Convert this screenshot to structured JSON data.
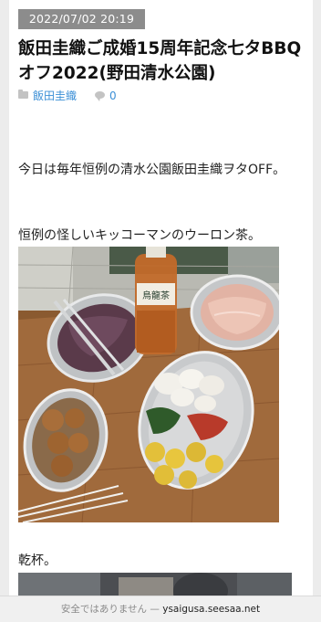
{
  "post": {
    "date": "2022/07/02 20:19",
    "title": "飯田圭織ご成婚15周年記念七タBBQオフ2022(野田清水公園)",
    "category_icon": "folder-icon",
    "author": "飯田圭織",
    "comment_icon": "speech-bubble-icon",
    "comment_count": "0",
    "paragraphs": [
      "今日は毎年恒例の清水公園飯田圭織ヲタOFF。",
      "恒例の怪しいキッコーマンのウーロン茶。",
      "乾杯。"
    ],
    "bottle_label": "烏龍茶"
  },
  "browser": {
    "security_text": "安全ではありません",
    "separator": "—",
    "domain": "ysaigusa.seesaa.net"
  }
}
